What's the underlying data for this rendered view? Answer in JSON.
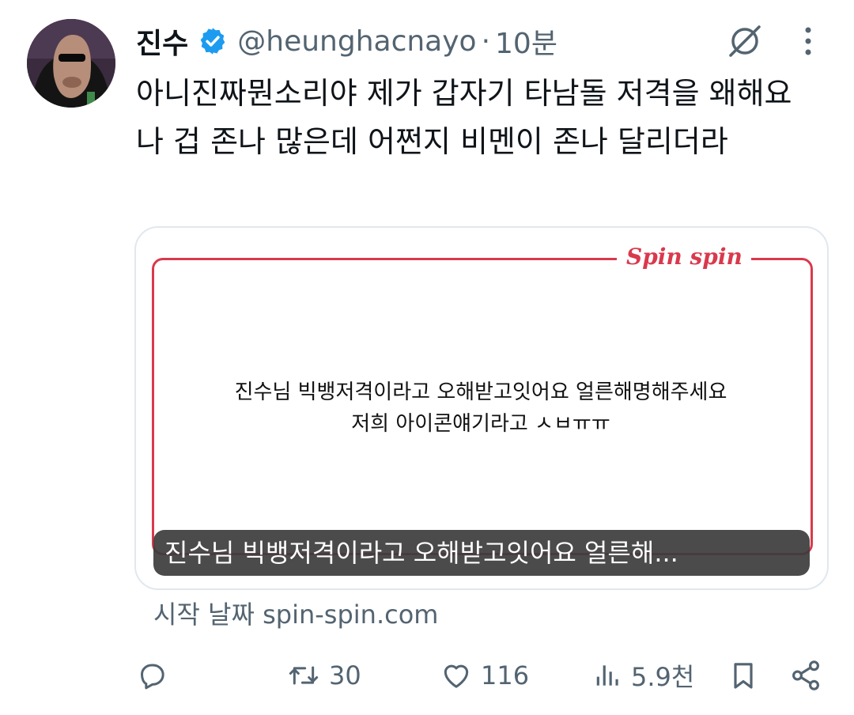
{
  "tweet": {
    "author": {
      "display_name": "진수",
      "verified": true,
      "handle": "@heunghacnayo",
      "separator": "·",
      "time": "10분"
    },
    "text": "아니진짜뭔소리야 제가 갑자기 타남돌 저격을 왜해요 나 겁 존나 많은데 어쩐지 비멘이 존나 달리더라",
    "card": {
      "brand": "Spin spin",
      "message_line1": "진수님 빅뱅저격이라고 오해받고잇어요 얼른해명해주세요",
      "message_line2": "저희 아이콘얘기라고 ㅅㅂㅠㅠ",
      "caption": "진수님 빅뱅저격이라고 오해받고잇어요 얼른해..."
    },
    "source": "시작 날짜 spin-spin.com",
    "actions": {
      "reply": {
        "icon": "reply-icon",
        "count": ""
      },
      "retweet": {
        "icon": "retweet-icon",
        "count": "30"
      },
      "like": {
        "icon": "heart-icon",
        "count": "116"
      },
      "views": {
        "icon": "views-icon",
        "count": "5.9천"
      },
      "bookmark": {
        "icon": "bookmark-icon"
      },
      "share": {
        "icon": "share-icon"
      }
    }
  },
  "colors": {
    "text": "#0f1419",
    "secondary": "#536471",
    "verified": "#1d9bf0",
    "brand": "#d9394d",
    "card_border": "#e1e8ed"
  }
}
